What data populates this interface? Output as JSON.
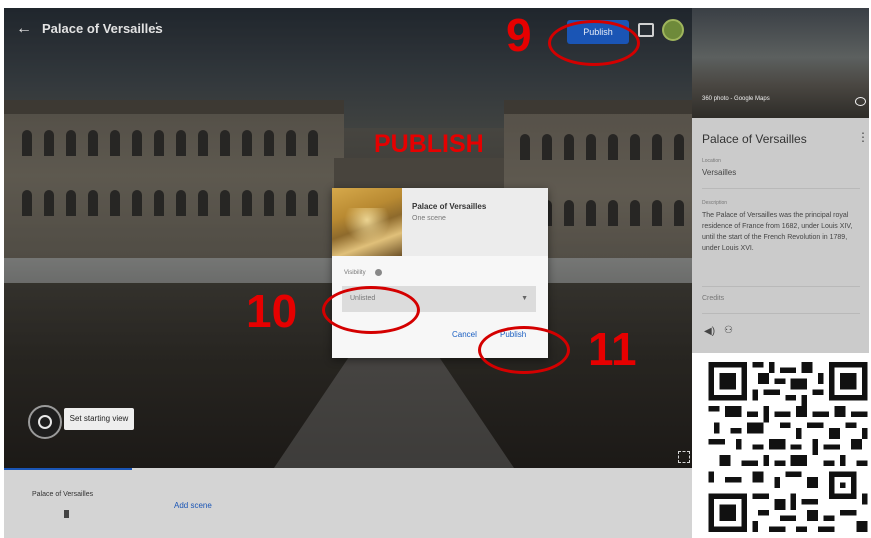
{
  "header": {
    "back_icon": "arrow-back-icon",
    "title": "Palace of Versailles",
    "info_glyph": "⋮",
    "publish_label": "Publish",
    "gallery_icon": "gallery-icon",
    "avatar": "user-avatar"
  },
  "annotations": {
    "heading": "PUBLISH",
    "step_9": "9",
    "step_10": "10",
    "step_11": "11",
    "color": "#e60000"
  },
  "dialog": {
    "title": "Palace of Versailles",
    "subtitle": "One scene",
    "visibility_label": "Visibility",
    "visibility_value": "Unlisted",
    "cancel_label": "Cancel",
    "publish_label": "Publish"
  },
  "viewer": {
    "starting_view_label": "Set starting view"
  },
  "bottom": {
    "scene_label": "Palace of Versailles",
    "add_scene_label": "Add scene"
  },
  "panel": {
    "image_caption": "360 photo - Google Maps",
    "title": "Palace of Versailles",
    "more_glyph": "⋮",
    "location_label": "Location",
    "location": "Versailles",
    "description_label": "Description",
    "description": "The Palace of Versailles was the principal royal residence of France from 1682, under Louis XIV, until the start of the French Revolution in 1789, under Louis XVI.",
    "credits_label": "Credits"
  },
  "colors": {
    "accent": "#1a55b5",
    "annotation": "#e60000"
  }
}
